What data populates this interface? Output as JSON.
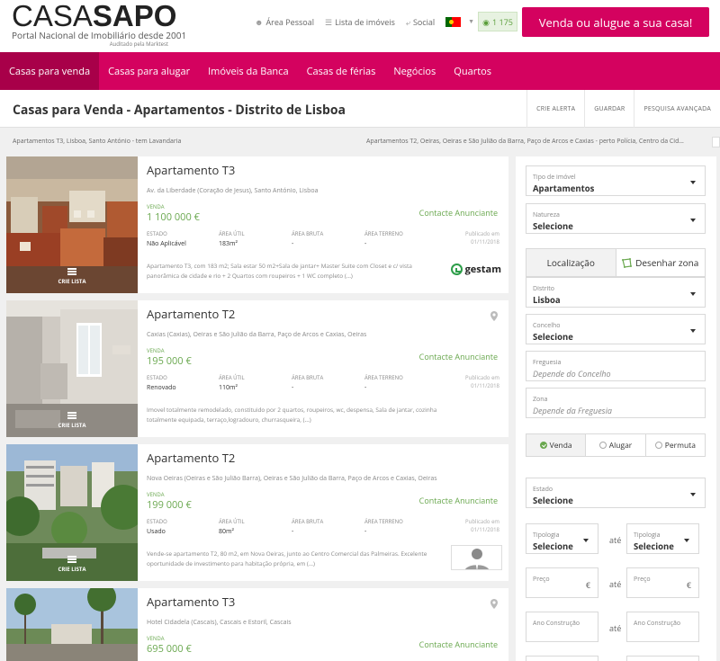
{
  "header": {
    "logo_part1": "CASA",
    "logo_part2": "SAPO",
    "tagline": "Portal Nacional de Imobiliário desde 2001",
    "audit": "Auditado pela Marktest",
    "links": {
      "area_pessoal": "Área Pessoal",
      "lista_imoveis": "Lista de imóveis",
      "social": "Social"
    },
    "views": "1 175",
    "cta": "Venda ou alugue a sua casa!"
  },
  "nav": {
    "items": [
      "Casas para venda",
      "Casas para alugar",
      "Imóveis da Banca",
      "Casas de férias",
      "Negócios",
      "Quartos"
    ]
  },
  "titlebar": {
    "title": "Casas para Venda - Apartamentos - Distrito de Lisboa",
    "actions": [
      "CRIE ALERTA",
      "GUARDAR",
      "PESQUISA AVANÇADA"
    ]
  },
  "breadcrumbs": {
    "left": "Apartamentos T3, Lisboa, Santo António - tem Lavandaria",
    "right": "Apartamentos T2, Oeiras, Oeiras e São Julião da Barra, Paço de Arcos e Caxias - perto Polícia, Centro da Cid..."
  },
  "listing_labels": {
    "venda": "VENDA",
    "contact": "Contacte Anunciante",
    "estado": "ESTADO",
    "area_util": "ÁREA ÚTIL",
    "area_bruta": "ÁREA BRUTA",
    "area_terreno": "ÁREA TERRENO",
    "published": "Publicado em",
    "crie_lista": "CRIE LISTA"
  },
  "listings": [
    {
      "title": "Apartamento T3",
      "address": "Av. da Liberdade (Coração de Jesus), Santo António, Lisboa",
      "price": "1 100 000 €",
      "estado": "Não Aplicável",
      "area_util": "183m²",
      "area_bruta": "-",
      "area_terreno": "-",
      "date": "01/11/2018",
      "desc": "Apartamento T3, com 183 m2; Sala estar 50 m2+Sala de jantar+ Master Suite com Closet e c/ vista panorâmica de cidade e rio + 2 Quartos com roupeiros + 1 WC completo (...)",
      "agency": "gestam"
    },
    {
      "title": "Apartamento T2",
      "address": "Caxias (Caxias), Oeiras e São Julião da Barra, Paço de Arcos e Caxias, Oeiras",
      "price": "195 000 €",
      "estado": "Renovado",
      "area_util": "110m²",
      "area_bruta": "-",
      "area_terreno": "-",
      "date": "01/11/2018",
      "desc": "Imovel totalmente remodelado, constituido por 2 quartos, roupeiros, wc, despensa, Sala de jantar, cozinha totalmente equipada, terraço,logradouro, churrasqueira, (...)"
    },
    {
      "title": "Apartamento T2",
      "address": "Nova Oeiras (Oeiras e São Julião Barra), Oeiras e São Julião da Barra, Paço de Arcos e Caxias, Oeiras",
      "price": "199 000 €",
      "estado": "Usado",
      "area_util": "80m²",
      "area_bruta": "-",
      "area_terreno": "-",
      "date": "01/11/2018",
      "desc": "Vende-se apartamento T2, 80 m2, em Nova Oeiras, junto ao Centro Comercial das Palmeiras. Excelente oportunidade de investimento para habitação própria, em (...)"
    },
    {
      "title": "Apartamento T3",
      "address": "Hotel Cidadela (Cascais), Cascais e Estoril, Cascais",
      "price": "695 000 €"
    }
  ],
  "sidebar": {
    "tipo_label": "Tipo de imóvel",
    "tipo_value": "Apartamentos",
    "natureza_label": "Natureza",
    "natureza_value": "Selecione",
    "tab_localizacao": "Localização",
    "tab_desenhar": "Desenhar zona",
    "distrito_label": "Distrito",
    "distrito_value": "Lisboa",
    "concelho_label": "Concelho",
    "concelho_value": "Selecione",
    "freguesia_label": "Freguesia",
    "freguesia_placeholder": "Depende do Concelho",
    "zona_label": "Zona",
    "zona_placeholder": "Depende da Freguesia",
    "radio_venda": "Venda",
    "radio_alugar": "Alugar",
    "radio_permuta": "Permuta",
    "estado_label": "Estado",
    "estado_value": "Selecione",
    "tipologia_label": "Tipologia",
    "tipologia_value": "Selecione",
    "ate": "até",
    "preco_label": "Preço",
    "euro": "€",
    "ano_label": "Ano Construção"
  }
}
